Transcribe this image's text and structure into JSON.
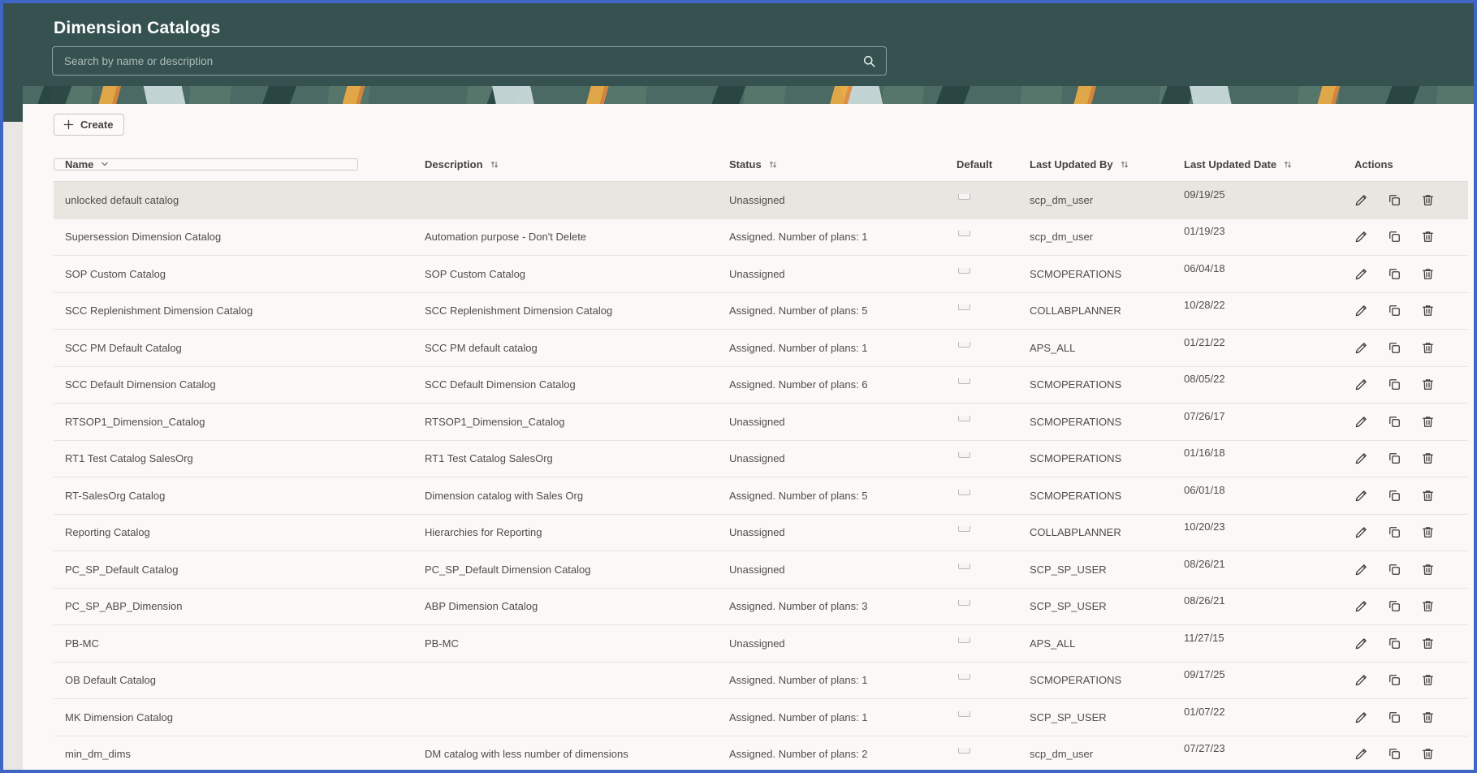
{
  "colors": {
    "frame_border": "#3f66c5",
    "header_bg": "#355150",
    "panel_bg": "#faf9f7",
    "row_highlight": "#e9e6e2",
    "banner_orange": "#e8aa46",
    "banner_light_blue": "#c9d9da",
    "banner_dark_teal": "#1f3a38"
  },
  "header": {
    "title": "Dimension Catalogs",
    "search_placeholder": "Search by name or description",
    "search_value": ""
  },
  "toolbar": {
    "create_label": "Create"
  },
  "table": {
    "columns": [
      {
        "label": "Name"
      },
      {
        "label": "Description"
      },
      {
        "label": "Status"
      },
      {
        "label": "Default"
      },
      {
        "label": "Last Updated By"
      },
      {
        "label": "Last Updated Date"
      },
      {
        "label": "Actions"
      }
    ],
    "rows": [
      {
        "name": "unlocked default catalog",
        "description": "",
        "status": "Unassigned",
        "default_checked": false,
        "updated_by": "scp_dm_user",
        "updated_date": "09/19/25",
        "selected": true
      },
      {
        "name": "Supersession Dimension Catalog",
        "description": "Automation purpose - Don't Delete",
        "status": "Assigned. Number of plans: 1",
        "default_checked": false,
        "updated_by": "scp_dm_user",
        "updated_date": "01/19/23",
        "selected": false
      },
      {
        "name": "SOP Custom Catalog",
        "description": "SOP Custom Catalog",
        "status": "Unassigned",
        "default_checked": false,
        "updated_by": "SCMOPERATIONS",
        "updated_date": "06/04/18",
        "selected": false
      },
      {
        "name": "SCC Replenishment Dimension Catalog",
        "description": "SCC Replenishment Dimension Catalog",
        "status": "Assigned. Number of plans: 5",
        "default_checked": false,
        "updated_by": "COLLABPLANNER",
        "updated_date": "10/28/22",
        "selected": false
      },
      {
        "name": "SCC PM Default Catalog",
        "description": "SCC PM default catalog",
        "status": "Assigned. Number of plans: 1",
        "default_checked": false,
        "updated_by": "APS_ALL",
        "updated_date": "01/21/22",
        "selected": false
      },
      {
        "name": "SCC Default Dimension Catalog",
        "description": "SCC Default Dimension Catalog",
        "status": "Assigned. Number of plans: 6",
        "default_checked": false,
        "updated_by": "SCMOPERATIONS",
        "updated_date": "08/05/22",
        "selected": false
      },
      {
        "name": "RTSOP1_Dimension_Catalog",
        "description": "RTSOP1_Dimension_Catalog",
        "status": "Unassigned",
        "default_checked": false,
        "updated_by": "SCMOPERATIONS",
        "updated_date": "07/26/17",
        "selected": false
      },
      {
        "name": "RT1 Test Catalog SalesOrg",
        "description": "RT1 Test Catalog SalesOrg",
        "status": "Unassigned",
        "default_checked": false,
        "updated_by": "SCMOPERATIONS",
        "updated_date": "01/16/18",
        "selected": false
      },
      {
        "name": "RT-SalesOrg Catalog",
        "description": "Dimension catalog with Sales Org",
        "status": "Assigned. Number of plans: 5",
        "default_checked": false,
        "updated_by": "SCMOPERATIONS",
        "updated_date": "06/01/18",
        "selected": false
      },
      {
        "name": "Reporting Catalog",
        "description": "Hierarchies for Reporting",
        "status": "Unassigned",
        "default_checked": false,
        "updated_by": "COLLABPLANNER",
        "updated_date": "10/20/23",
        "selected": false
      },
      {
        "name": "PC_SP_Default Catalog",
        "description": "PC_SP_Default Dimension Catalog",
        "status": "Unassigned",
        "default_checked": false,
        "updated_by": "SCP_SP_USER",
        "updated_date": "08/26/21",
        "selected": false
      },
      {
        "name": "PC_SP_ABP_Dimension",
        "description": "ABP Dimension Catalog",
        "status": "Assigned. Number of plans: 3",
        "default_checked": false,
        "updated_by": "SCP_SP_USER",
        "updated_date": "08/26/21",
        "selected": false
      },
      {
        "name": "PB-MC",
        "description": "PB-MC",
        "status": "Unassigned",
        "default_checked": false,
        "updated_by": "APS_ALL",
        "updated_date": "11/27/15",
        "selected": false
      },
      {
        "name": "OB Default Catalog",
        "description": "",
        "status": "Assigned. Number of plans: 1",
        "default_checked": false,
        "updated_by": "SCMOPERATIONS",
        "updated_date": "09/17/25",
        "selected": false
      },
      {
        "name": "MK Dimension Catalog",
        "description": "",
        "status": "Assigned. Number of plans: 1",
        "default_checked": false,
        "updated_by": "SCP_SP_USER",
        "updated_date": "01/07/22",
        "selected": false
      },
      {
        "name": "min_dm_dims",
        "description": "DM catalog with less number of dimensions",
        "status": "Assigned. Number of plans: 2",
        "default_checked": false,
        "updated_by": "scp_dm_user",
        "updated_date": "07/27/23",
        "selected": false
      }
    ]
  }
}
